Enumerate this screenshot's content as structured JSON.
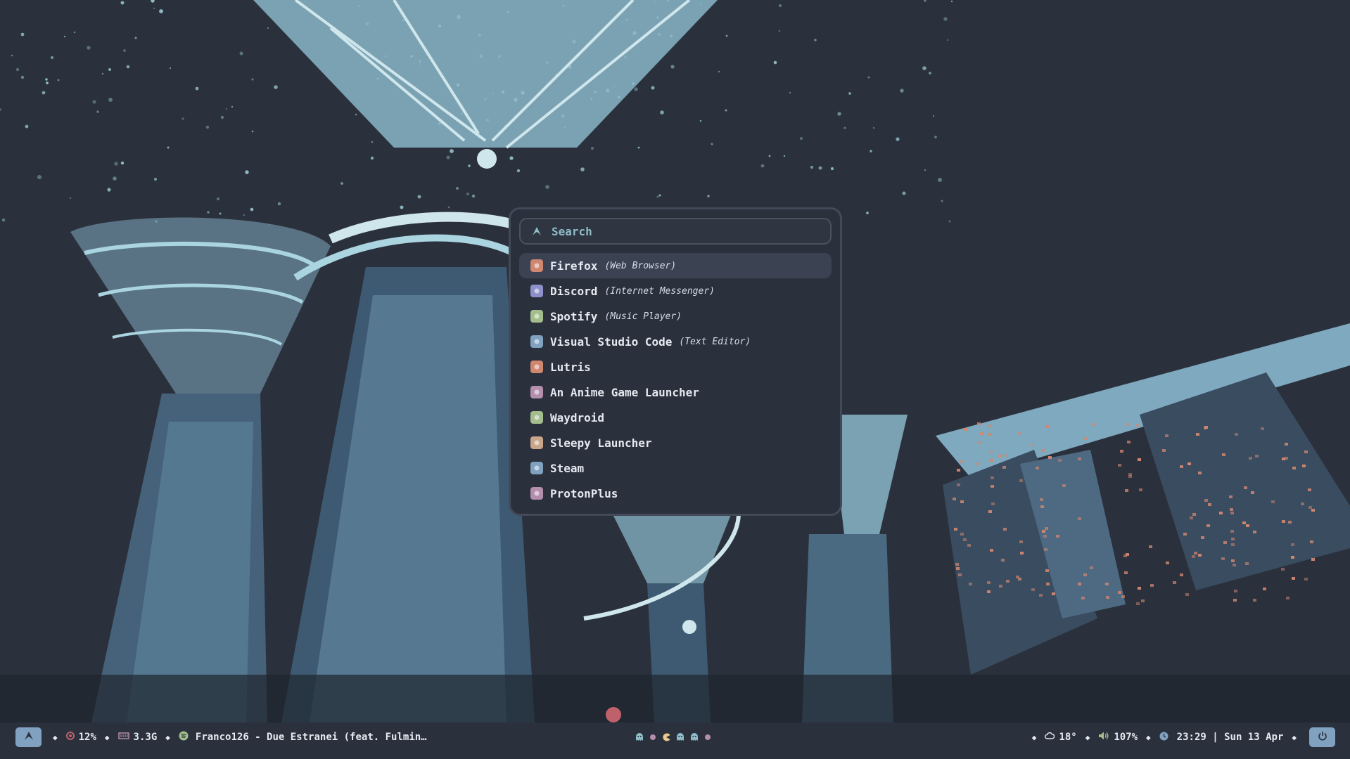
{
  "launcher": {
    "search_placeholder": "Search",
    "search_icon": "arch-logo-icon",
    "apps": [
      {
        "name": "Firefox",
        "desc": "(Web Browser)",
        "icon": "firefox-icon",
        "color": "#d08770"
      },
      {
        "name": "Discord",
        "desc": "(Internet Messenger)",
        "icon": "discord-icon",
        "color": "#8e91c9"
      },
      {
        "name": "Spotify",
        "desc": "(Music Player)",
        "icon": "spotify-icon",
        "color": "#a3be8c"
      },
      {
        "name": "Visual Studio Code",
        "desc": "(Text Editor)",
        "icon": "vscode-icon",
        "color": "#81a1c1"
      },
      {
        "name": "Lutris",
        "desc": "",
        "icon": "lutris-icon",
        "color": "#d08770"
      },
      {
        "name": "An Anime Game Launcher",
        "desc": "",
        "icon": "anime-game-launcher-icon",
        "color": "#b48ead"
      },
      {
        "name": "Waydroid",
        "desc": "",
        "icon": "waydroid-icon",
        "color": "#a3be8c"
      },
      {
        "name": "Sleepy Launcher",
        "desc": "",
        "icon": "sleepy-launcher-icon",
        "color": "#c9a58a"
      },
      {
        "name": "Steam",
        "desc": "",
        "icon": "steam-icon",
        "color": "#81a1c1"
      },
      {
        "name": "ProtonPlus",
        "desc": "",
        "icon": "protonplus-icon",
        "color": "#b48ead"
      }
    ]
  },
  "bar": {
    "cpu": "12%",
    "memory": "3.3G",
    "media": "Franco126 - Due Estranei (feat. Fulmin…",
    "weather": "18°",
    "volume": "107%",
    "clock": "23:29 | Sun 13 Apr",
    "separator": "◆",
    "workspace_icons": [
      "ghost-icon",
      "dot-icon",
      "pacman-icon",
      "ghost-icon",
      "ghost-icon",
      "dot-icon"
    ]
  },
  "colors": {
    "accent": "#81a1c1",
    "background": "#2b313c",
    "cyan": "#8fbcc7",
    "red": "#bf616a",
    "green": "#a3be8c",
    "purple": "#b48ead",
    "yellow": "#ebcb8b"
  }
}
